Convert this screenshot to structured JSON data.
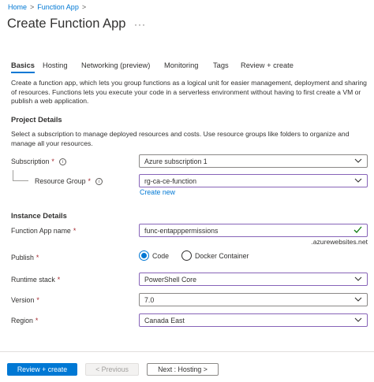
{
  "breadcrumb": {
    "items": [
      "Home",
      "Function App"
    ],
    "separator": ">"
  },
  "page_title": "Create Function App",
  "more_icon": "ellipsis-icon",
  "tabs": [
    "Basics",
    "Hosting",
    "Networking (preview)",
    "Monitoring",
    "Tags",
    "Review + create"
  ],
  "intro": "Create a function app, which lets you group functions as a logical unit for easier management, deployment and sharing of resources. Functions lets you execute your code in a serverless environment without having to first create a VM or publish a web application.",
  "project": {
    "heading": "Project Details",
    "description": "Select a subscription to manage deployed resources and costs. Use resource groups like folders to organize and manage all your resources.",
    "subscription_label": "Subscription",
    "subscription_value": "Azure subscription 1",
    "resource_group_label": "Resource Group",
    "resource_group_value": "rg-ca-ce-function",
    "create_new": "Create new"
  },
  "instance": {
    "heading": "Instance Details",
    "name_label": "Function App name",
    "name_value": "func-entapppermissions",
    "name_suffix": ".azurewebsites.net",
    "publish_label": "Publish",
    "publish_options": [
      "Code",
      "Docker Container"
    ],
    "publish_selected": "Code",
    "runtime_label": "Runtime stack",
    "runtime_value": "PowerShell Core",
    "version_label": "Version",
    "version_value": "7.0",
    "region_label": "Region",
    "region_value": "Canada East"
  },
  "required_mark": "*",
  "footer": {
    "review_create": "Review + create",
    "previous": "< Previous",
    "next": "Next : Hosting >"
  },
  "colors": {
    "accent": "#0078d4",
    "focus_border": "#8764b8",
    "required": "#a4262c"
  }
}
